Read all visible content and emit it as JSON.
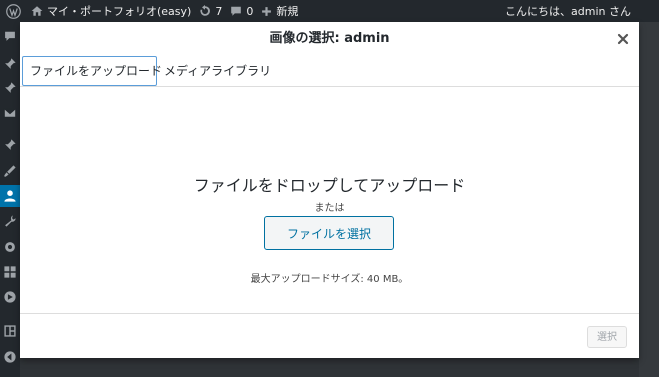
{
  "admin_bar": {
    "site_name": "マイ・ポートフォリオ(easy)",
    "updates_count": "7",
    "comments_count": "0",
    "new_label": "新規",
    "greeting": "こんにちは、admin さん"
  },
  "modal": {
    "title": "画像の選択: admin",
    "close_icon": "close-icon",
    "tabs": [
      {
        "label": "ファイルをアップロード",
        "active": true
      },
      {
        "label": "メディアライブラリ",
        "active": false
      }
    ],
    "uploader": {
      "drop_text": "ファイルをドロップしてアップロード",
      "or_text": "または",
      "select_files_label": "ファイルを選択",
      "max_size_text": "最大アップロードサイズ: 40 MB。"
    },
    "toolbar": {
      "select_label": "選択"
    }
  },
  "colors": {
    "admin_bar_bg": "#23282d",
    "accent": "#0071a1",
    "active_menu": "#0073aa"
  }
}
